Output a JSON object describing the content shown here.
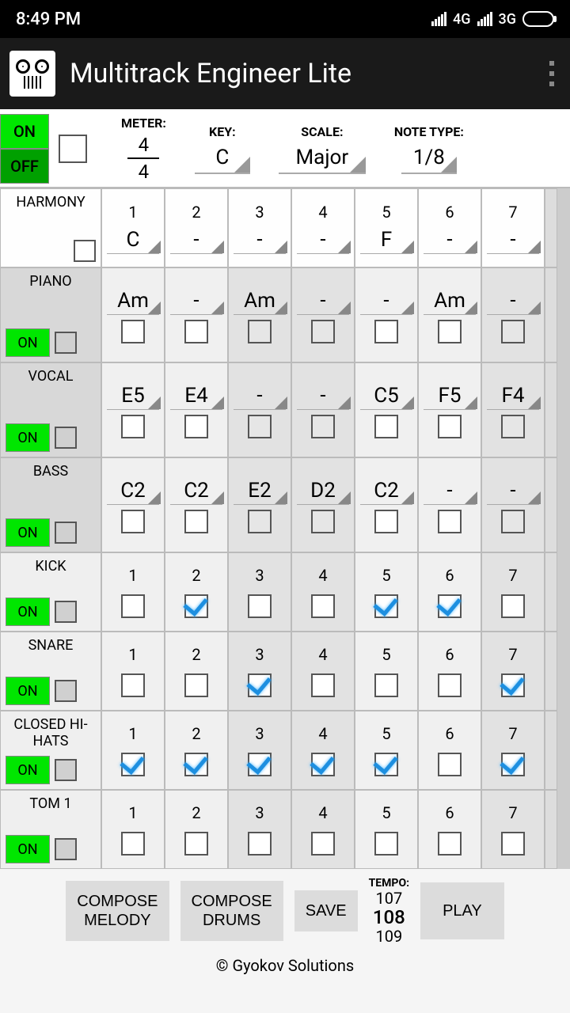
{
  "status": {
    "time": "8:49 PM",
    "net1": "4G",
    "net2": "3G"
  },
  "app": {
    "title": "Multitrack Engineer Lite"
  },
  "toggles": {
    "on": "ON",
    "off": "OFF"
  },
  "settings": {
    "meter_label": "METER:",
    "meter_top": "4",
    "meter_bot": "4",
    "key_label": "KEY:",
    "key_val": "C",
    "scale_label": "SCALE:",
    "scale_val": "Major",
    "note_label": "NOTE TYPE:",
    "note_val": "1/8"
  },
  "cols": [
    "1",
    "2",
    "3",
    "4",
    "5",
    "6",
    "7"
  ],
  "tracks": {
    "harmony": {
      "name": "HARMONY",
      "vals": [
        "C",
        "-",
        "-",
        "-",
        "F",
        "-",
        "-"
      ]
    },
    "piano": {
      "name": "PIANO",
      "on": "ON",
      "vals": [
        "Am",
        "-",
        "Am",
        "-",
        "-",
        "Am",
        "-"
      ]
    },
    "vocal": {
      "name": "VOCAL",
      "on": "ON",
      "vals": [
        "E5",
        "E4",
        "-",
        "-",
        "C5",
        "F5",
        "F4"
      ]
    },
    "bass": {
      "name": "BASS",
      "on": "ON",
      "vals": [
        "C2",
        "C2",
        "E2",
        "D2",
        "C2",
        "-",
        "-"
      ]
    },
    "kick": {
      "name": "KICK",
      "on": "ON",
      "chk": [
        false,
        true,
        false,
        false,
        true,
        true,
        false
      ]
    },
    "snare": {
      "name": "SNARE",
      "on": "ON",
      "chk": [
        false,
        false,
        true,
        false,
        false,
        false,
        true
      ]
    },
    "hihat": {
      "name": "CLOSED HI-HATS",
      "on": "ON",
      "chk": [
        true,
        true,
        true,
        true,
        true,
        false,
        true
      ]
    },
    "tom1": {
      "name": "TOM 1",
      "on": "ON",
      "chk": [
        false,
        false,
        false,
        false,
        false,
        false,
        false
      ]
    }
  },
  "bottom": {
    "compose_melody": "COMPOSE\nMELODY",
    "compose_drums": "COMPOSE\nDRUMS",
    "save": "SAVE",
    "play": "PLAY",
    "tempo_label": "TEMPO:",
    "tempo_prev": "107",
    "tempo": "108",
    "tempo_next": "109"
  },
  "footer": "© Gyokov Solutions"
}
